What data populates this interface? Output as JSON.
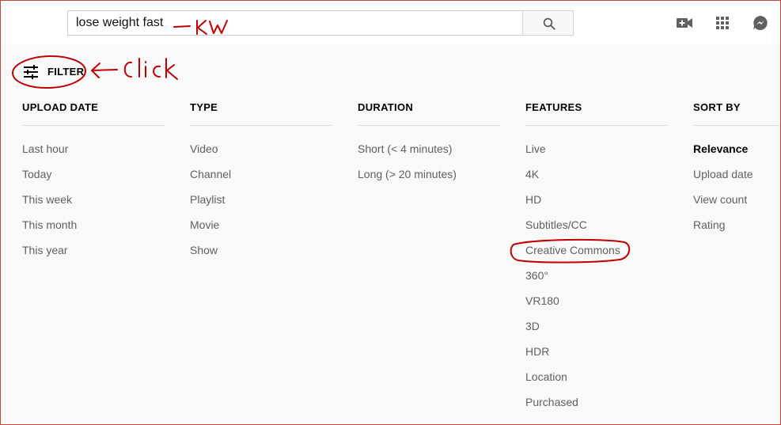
{
  "search": {
    "query": "lose weight fast"
  },
  "icons": {
    "search": "search-icon",
    "create_video": "video-camera-plus-icon",
    "apps": "apps-grid-icon",
    "messages": "messages-icon",
    "filter": "tune-sliders-icon"
  },
  "filter_button": {
    "label": "FILTER"
  },
  "annotations": {
    "kw": "KW",
    "click": "Click",
    "color": "#c00000"
  },
  "filters": {
    "upload_date": {
      "header": "UPLOAD DATE",
      "options": [
        "Last hour",
        "Today",
        "This week",
        "This month",
        "This year"
      ]
    },
    "type": {
      "header": "TYPE",
      "options": [
        "Video",
        "Channel",
        "Playlist",
        "Movie",
        "Show"
      ]
    },
    "duration": {
      "header": "DURATION",
      "options": [
        "Short (< 4 minutes)",
        "Long (> 20 minutes)"
      ]
    },
    "features": {
      "header": "FEATURES",
      "options": [
        "Live",
        "4K",
        "HD",
        "Subtitles/CC",
        "Creative Commons",
        "360°",
        "VR180",
        "3D",
        "HDR",
        "Location",
        "Purchased"
      ]
    },
    "sort_by": {
      "header": "SORT BY",
      "options": [
        "Relevance",
        "Upload date",
        "View count",
        "Rating"
      ],
      "selected": "Relevance"
    }
  }
}
